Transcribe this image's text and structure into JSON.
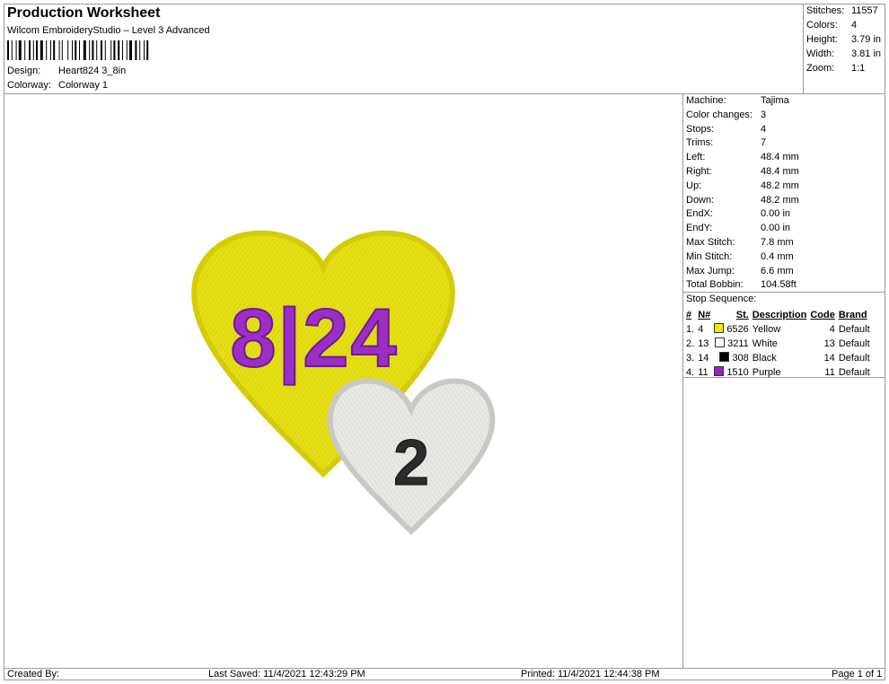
{
  "header": {
    "title": "Production Worksheet",
    "software": "Wilcom EmbroideryStudio – Level 3 Advanced",
    "design_label": "Design:",
    "design_value": "Heart824 3_8in",
    "colorway_label": "Colorway:",
    "colorway_value": "Colorway 1"
  },
  "stats": [
    {
      "label": "Stitches:",
      "value": "11557"
    },
    {
      "label": "Colors:",
      "value": "4"
    },
    {
      "label": "Height:",
      "value": "3.79 in"
    },
    {
      "label": "Width:",
      "value": "3.81 in"
    },
    {
      "label": "Zoom:",
      "value": "1:1"
    }
  ],
  "machine_info": [
    {
      "label": "Machine:",
      "value": "Tajima"
    },
    {
      "label": "Color changes:",
      "value": "3"
    },
    {
      "label": "Stops:",
      "value": "4"
    },
    {
      "label": "Trims:",
      "value": "7"
    },
    {
      "label": "Left:",
      "value": "48.4 mm"
    },
    {
      "label": "Right:",
      "value": "48.4 mm"
    },
    {
      "label": "Up:",
      "value": "48.2 mm"
    },
    {
      "label": "Down:",
      "value": "48.2 mm"
    },
    {
      "label": "EndX:",
      "value": "0.00 in"
    },
    {
      "label": "EndY:",
      "value": "0.00 in"
    },
    {
      "label": "Max Stitch:",
      "value": "7.8 mm"
    },
    {
      "label": "Min Stitch:",
      "value": "0.4 mm"
    },
    {
      "label": "Max Jump:",
      "value": "6.6 mm"
    },
    {
      "label": "Total Bobbin:",
      "value": "104.58ft"
    }
  ],
  "stop_sequence": {
    "title": "Stop Sequence:",
    "columns": [
      "#",
      "N#",
      "St.",
      "Description",
      "Code",
      "Brand"
    ],
    "rows": [
      {
        "num": "1.",
        "needle": "4",
        "color": "#f2ea00",
        "stitches": "6526",
        "description": "Yellow",
        "code": "4",
        "brand": "Default"
      },
      {
        "num": "2.",
        "needle": "13",
        "color": "#ffffff",
        "stitches": "3211",
        "description": "White",
        "code": "13",
        "brand": "Default"
      },
      {
        "num": "3.",
        "needle": "14",
        "color": "#000000",
        "stitches": "308",
        "description": "Black",
        "code": "14",
        "brand": "Default"
      },
      {
        "num": "4.",
        "needle": "11",
        "color": "#9b1fc9",
        "stitches": "1510",
        "description": "Purple",
        "code": "11",
        "brand": "Default"
      }
    ]
  },
  "design_preview": {
    "big_heart_text": "8|24",
    "small_heart_text": "2",
    "big_heart_color": "#e3dc12",
    "small_heart_color": "#e6e6e2",
    "text_purple": "#9b2fc4",
    "text_black": "#2b2b2b"
  },
  "footer": {
    "created_by": "Created By:",
    "last_saved": "Last Saved: 11/4/2021 12:43:29 PM",
    "printed": "Printed: 11/4/2021 12:44:38 PM",
    "page": "Page 1 of 1"
  }
}
